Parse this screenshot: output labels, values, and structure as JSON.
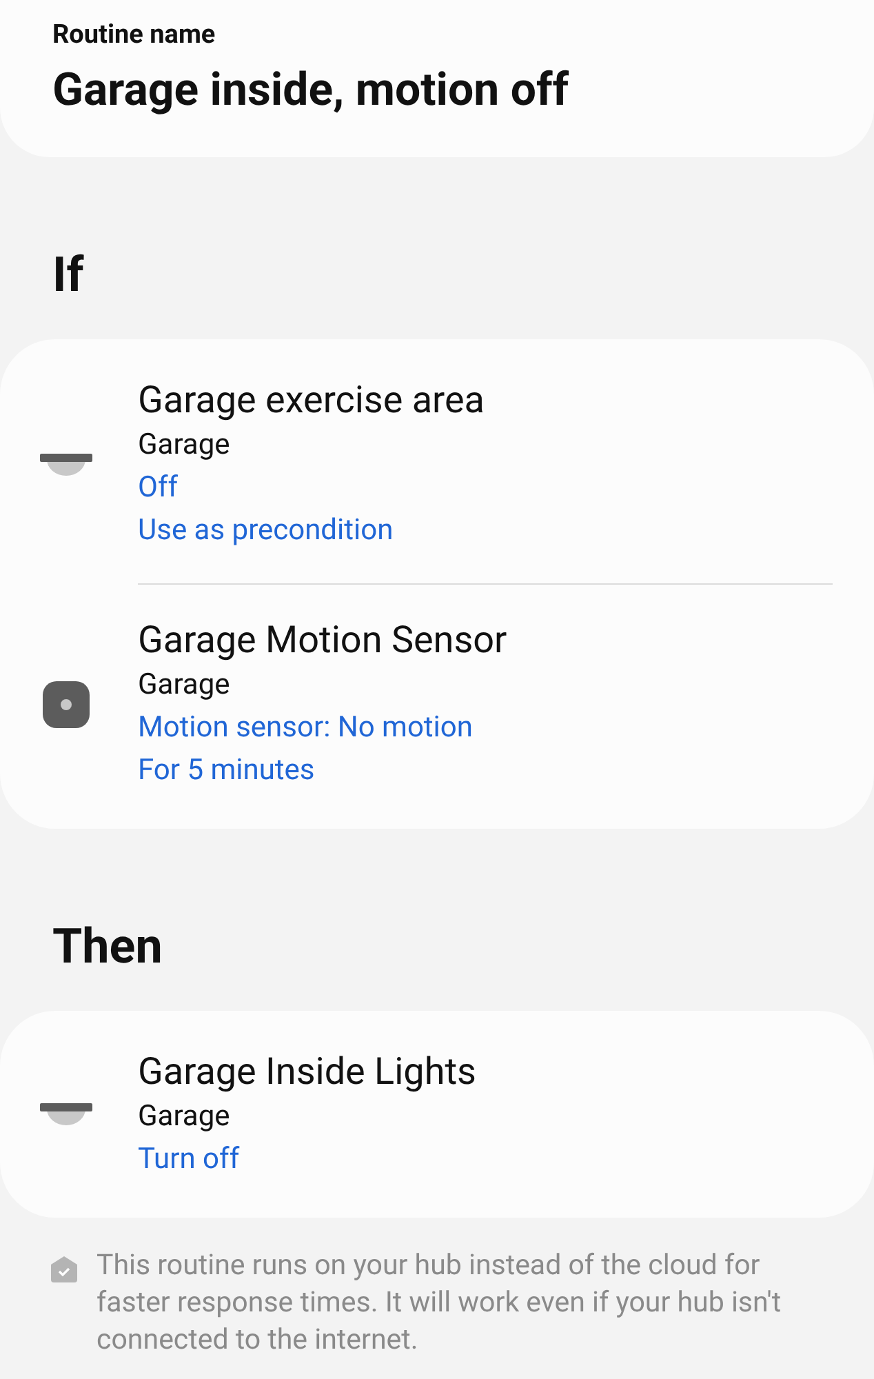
{
  "routine": {
    "label": "Routine name",
    "name": "Garage inside, motion off"
  },
  "if": {
    "heading": "If",
    "devices": [
      {
        "kind": "light",
        "name": "Garage exercise area",
        "room": "Garage",
        "details": [
          "Off",
          "Use as precondition"
        ]
      },
      {
        "kind": "motion",
        "name": "Garage Motion Sensor",
        "room": "Garage",
        "details": [
          "Motion sensor: No motion",
          "For 5 minutes"
        ]
      }
    ]
  },
  "then": {
    "heading": "Then",
    "devices": [
      {
        "kind": "light",
        "name": "Garage Inside Lights",
        "room": "Garage",
        "details": [
          "Turn off"
        ]
      }
    ]
  },
  "note": "This routine runs on your hub instead of the cloud for faster response times. It will work even if your hub isn't connected to the internet."
}
